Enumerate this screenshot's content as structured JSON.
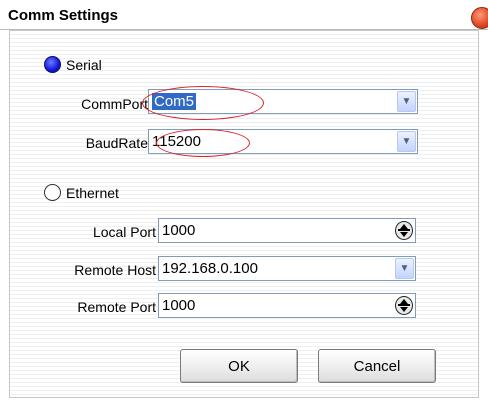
{
  "window": {
    "title": "Comm Settings"
  },
  "serial": {
    "label": "Serial",
    "selected": true,
    "comm_port_label": "CommPort",
    "comm_port_value": "Com5",
    "baud_rate_label": "BaudRate",
    "baud_rate_value": "115200"
  },
  "ethernet": {
    "label": "Ethernet",
    "selected": false,
    "local_port_label": "Local Port",
    "local_port_value": "1000",
    "remote_host_label": "Remote Host",
    "remote_host_value": "192.168.0.100",
    "remote_port_label": "Remote Port",
    "remote_port_value": "1000"
  },
  "buttons": {
    "ok": "OK",
    "cancel": "Cancel"
  },
  "icons": {
    "close": "close-icon",
    "dropdown": "chevron-down-icon",
    "spinner": "spinner-icon"
  },
  "colors": {
    "accent": "#1218d8",
    "annotation": "#d8232a",
    "selection": "#316ac5"
  }
}
